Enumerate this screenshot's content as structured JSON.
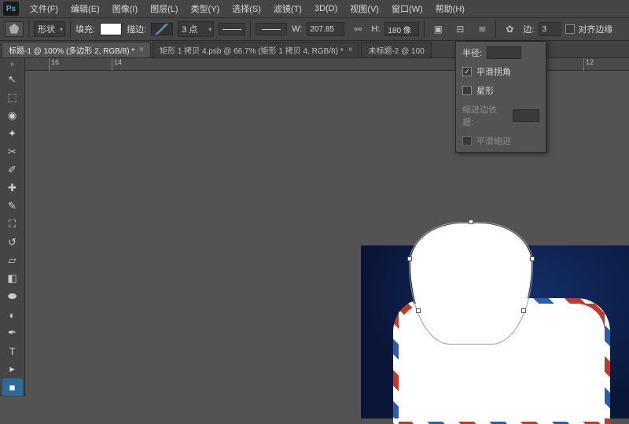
{
  "menu": {
    "items": [
      "文件(F)",
      "编辑(E)",
      "图像(I)",
      "图层(L)",
      "类型(Y)",
      "选择(S)",
      "滤镜(T)",
      "3D(D)",
      "视图(V)",
      "窗口(W)",
      "帮助(H)"
    ]
  },
  "options": {
    "shapeMode": "形状",
    "fillLabel": "填充:",
    "strokeLabel": "描边:",
    "strokeWidth": "3 点",
    "wLabel": "W:",
    "wValue": "207.85",
    "hLabel": "H:",
    "hValue": "180 像",
    "sidesLabel": "边:",
    "sidesValue": "3",
    "alignEdgesLabel": "对齐边缘"
  },
  "tabs": [
    {
      "label": "标题-1 @ 100% (多边形 2, RGB/8) *",
      "active": true
    },
    {
      "label": "矩形 1 拷贝 4.psb @ 66.7% (矩形 1 拷贝 4, RGB/8) *",
      "active": false
    },
    {
      "label": "未标题-2 @ 100",
      "active": false
    }
  ],
  "ruler": {
    "ticks": [
      {
        "pos": 30,
        "label": "16"
      },
      {
        "pos": 110,
        "label": "14"
      },
      {
        "pos": 260,
        "label": ""
      },
      {
        "pos": 410,
        "label": ""
      },
      {
        "pos": 560,
        "label": ""
      },
      {
        "pos": 710,
        "label": "12"
      }
    ]
  },
  "popup": {
    "radiusLabel": "半径:",
    "smoothCornerLabel": "平滑拐角",
    "smoothCornerChecked": true,
    "starLabel": "星形",
    "starChecked": false,
    "indentLabel": "缩进边依据:",
    "smoothIndentLabel": "平滑缩进",
    "smoothIndentChecked": false
  },
  "tools": [
    {
      "name": "move",
      "glyph": "↖"
    },
    {
      "name": "marquee",
      "glyph": "⬚"
    },
    {
      "name": "lasso",
      "glyph": "⌦"
    },
    {
      "name": "wand",
      "glyph": "✦"
    },
    {
      "name": "crop",
      "glyph": "✂"
    },
    {
      "name": "eyedropper",
      "glyph": "✎"
    },
    {
      "name": "heal",
      "glyph": "✚"
    },
    {
      "name": "brush",
      "glyph": "🖌"
    },
    {
      "name": "stamp",
      "glyph": "⛶"
    },
    {
      "name": "history-brush",
      "glyph": "↺"
    },
    {
      "name": "eraser",
      "glyph": "▱"
    },
    {
      "name": "gradient",
      "glyph": "◧"
    },
    {
      "name": "blur",
      "glyph": "⬬"
    },
    {
      "name": "dodge",
      "glyph": "◐"
    },
    {
      "name": "pen",
      "glyph": "✒"
    },
    {
      "name": "type",
      "glyph": "T"
    },
    {
      "name": "path-select",
      "glyph": "▸"
    },
    {
      "name": "shape",
      "glyph": "■"
    }
  ]
}
